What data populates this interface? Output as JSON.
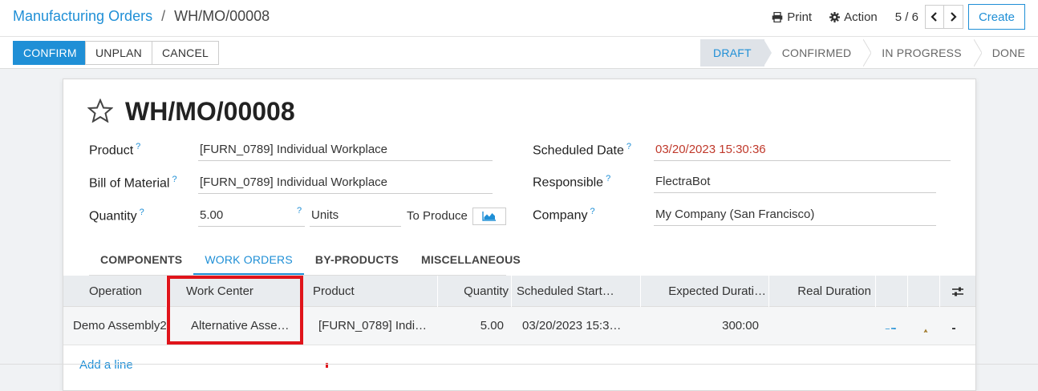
{
  "breadcrumb": {
    "parent": "Manufacturing Orders",
    "separator": "/",
    "current": "WH/MO/00008"
  },
  "topbar": {
    "print_label": "Print",
    "action_label": "Action",
    "pager": "5 / 6",
    "create_label": "Create"
  },
  "buttons": {
    "confirm": "CONFIRM",
    "unplan": "UNPLAN",
    "cancel": "CANCEL"
  },
  "statusbar": {
    "stages": [
      "DRAFT",
      "CONFIRMED",
      "IN PROGRESS",
      "DONE"
    ],
    "active": "DRAFT"
  },
  "form": {
    "title": "WH/MO/00008",
    "product_label": "Product",
    "product_value": "[FURN_0789] Individual Workplace",
    "bom_label": "Bill of Material",
    "bom_value": "[FURN_0789] Individual Workplace",
    "quantity_label": "Quantity",
    "quantity_value": "5.00",
    "uom_value": "Units",
    "to_produce": "To Produce",
    "scheduled_label": "Scheduled Date",
    "scheduled_value": "03/20/2023 15:30:36",
    "responsible_label": "Responsible",
    "responsible_value": "FlectraBot",
    "company_label": "Company",
    "company_value": "My Company (San Francisco)",
    "help_mark": "?"
  },
  "tabs": [
    "COMPONENTS",
    "WORK ORDERS",
    "BY-PRODUCTS",
    "MISCELLANEOUS"
  ],
  "active_tab": "WORK ORDERS",
  "table": {
    "headers": [
      "Operation",
      "Work Center",
      "Product",
      "Quantity",
      "Scheduled Start…",
      "Expected Durati…",
      "Real Duration"
    ],
    "rows": [
      {
        "operation": "Demo Assembly2",
        "work_center": "Alternative Asse…",
        "product": "[FURN_0789] Indi…",
        "quantity": "5.00",
        "scheduled_start": "03/20/2023 15:3…",
        "expected_duration": "300:00",
        "real_duration": ""
      }
    ],
    "add_line": "Add a line"
  },
  "colors": {
    "accent": "#1f8fd6",
    "highlight": "#e0141b",
    "warning": "#a07a2c",
    "date_red": "#c0392b"
  },
  "icons": [
    "print-icon",
    "gear-icon",
    "chevron-left-icon",
    "chevron-right-icon",
    "star-icon",
    "bar-chart-icon",
    "external-link-icon",
    "warning-icon",
    "trash-icon",
    "settings-sliders-icon"
  ]
}
